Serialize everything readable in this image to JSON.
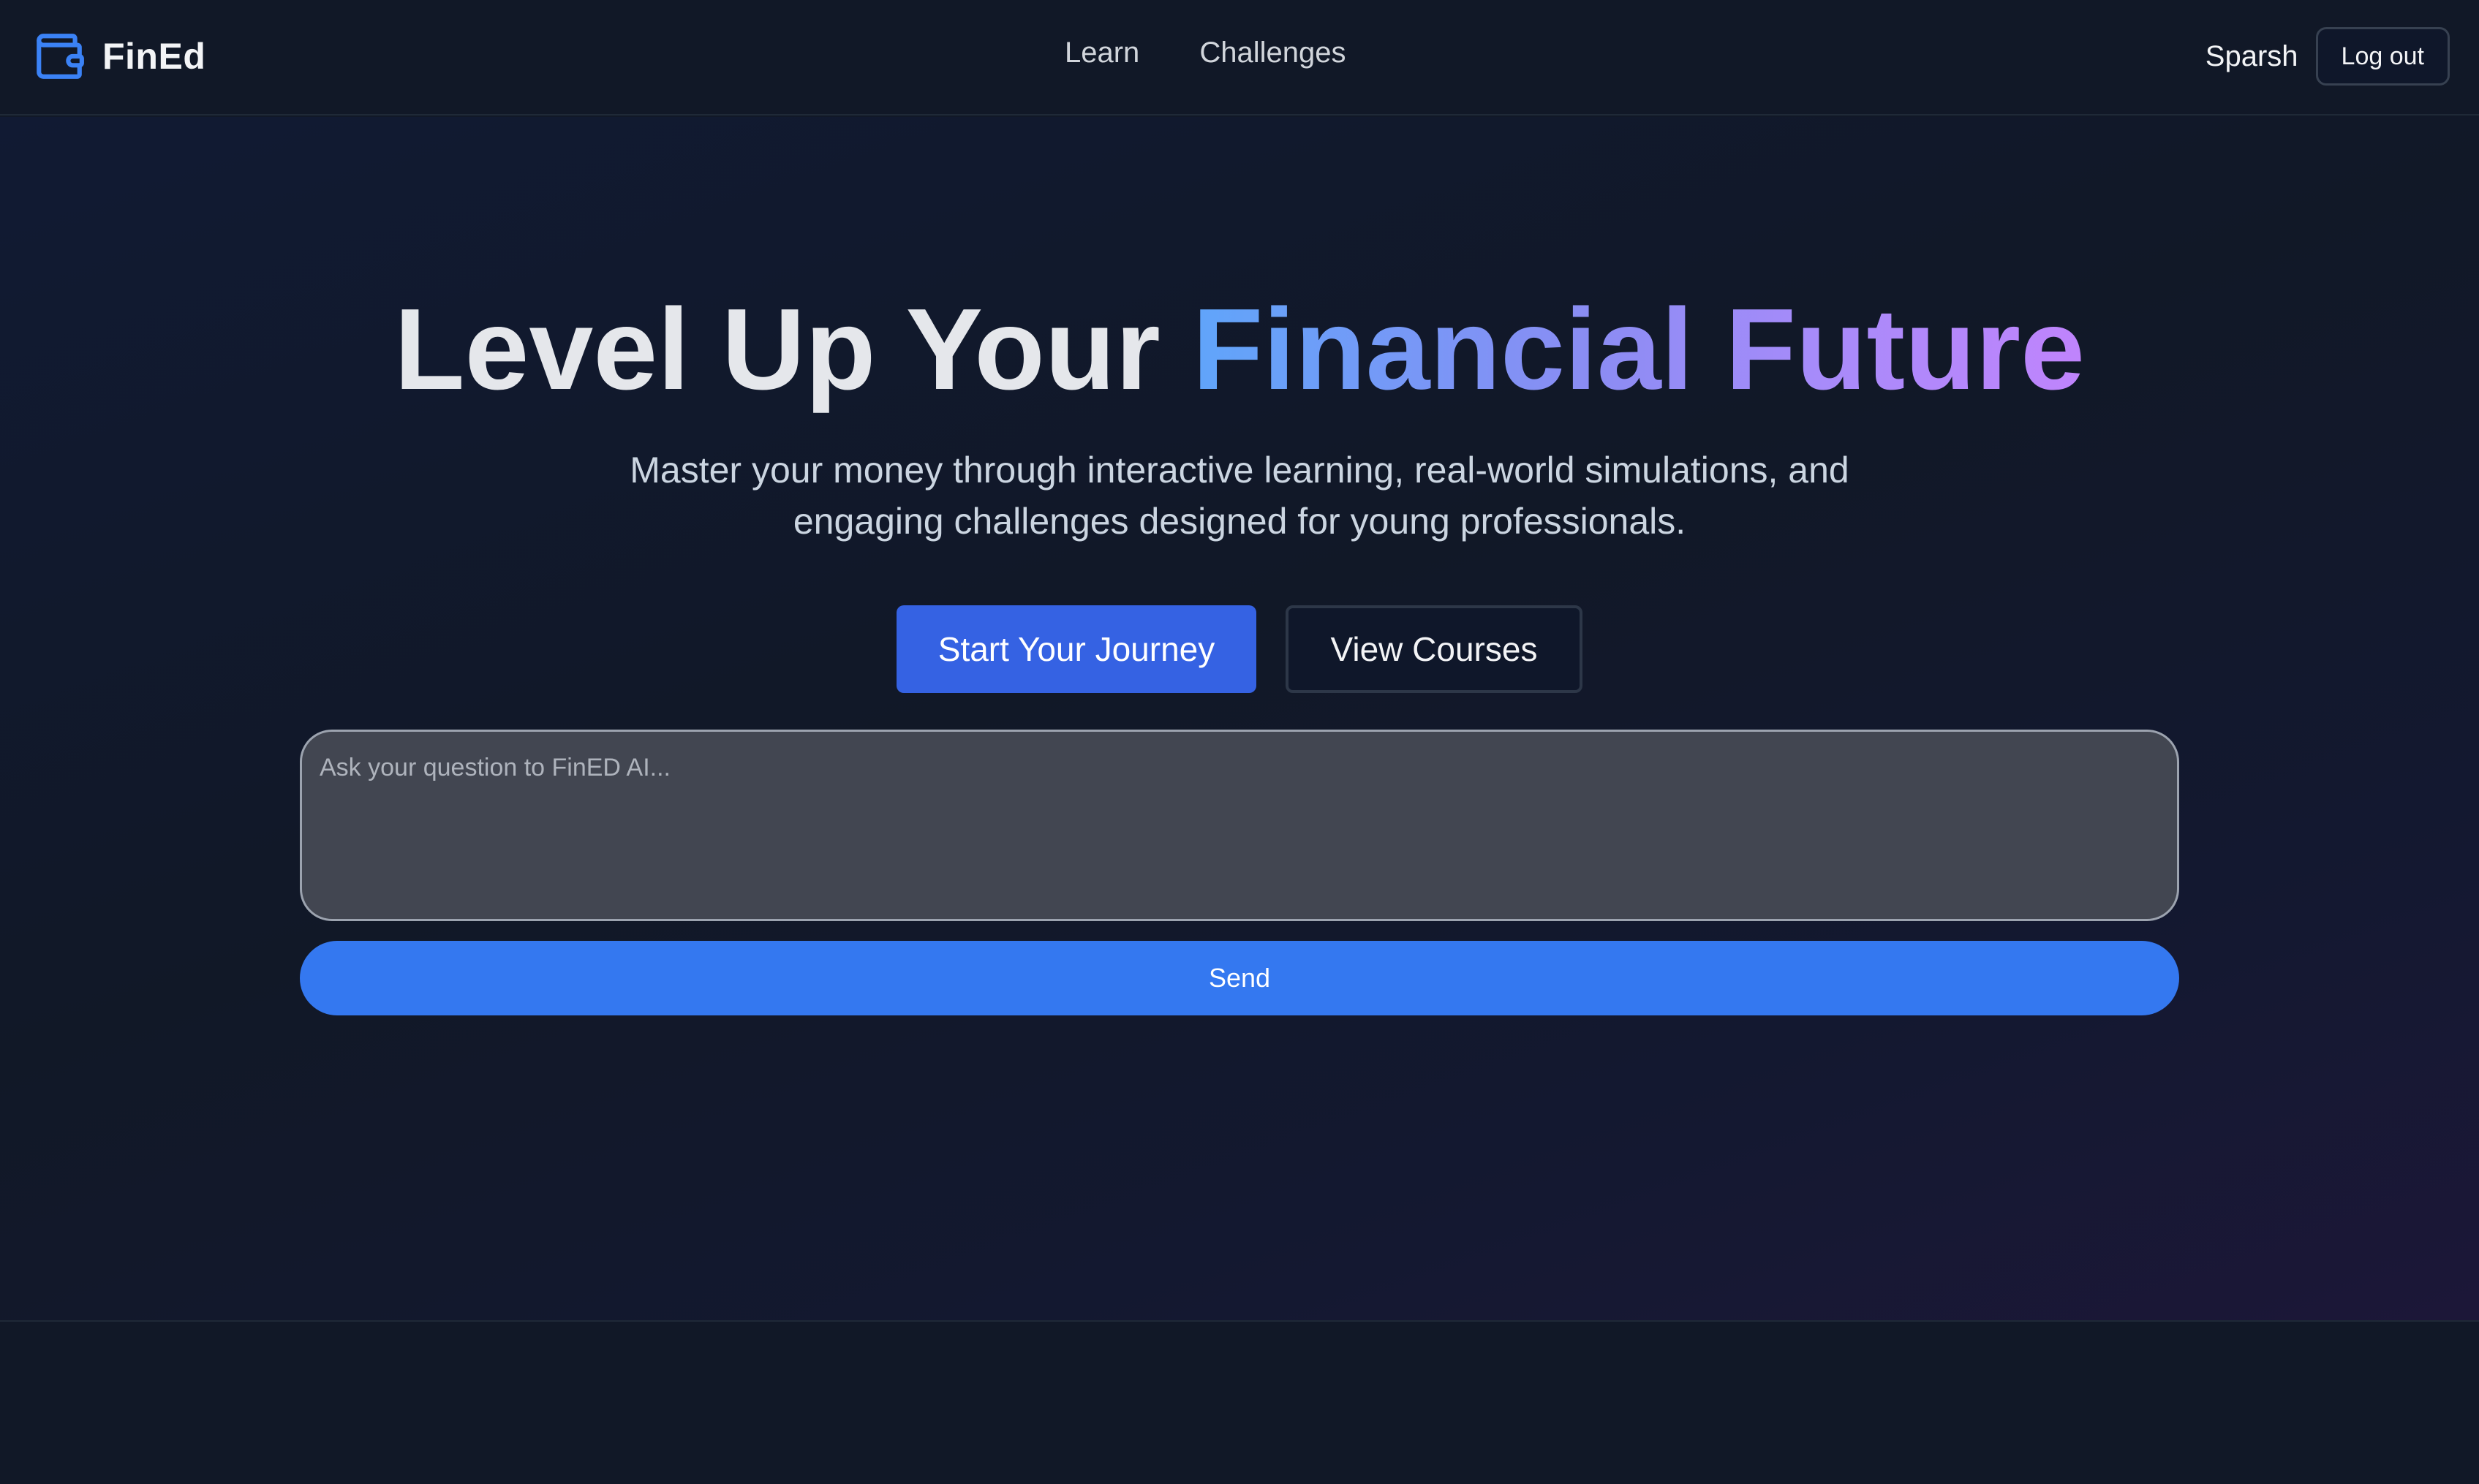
{
  "brand": {
    "name": "FinEd",
    "icon": "wallet-icon",
    "accent_color": "#3b82f6"
  },
  "nav": {
    "items": [
      {
        "label": "Learn"
      },
      {
        "label": "Challenges"
      }
    ]
  },
  "user": {
    "name": "Sparsh",
    "logout_label": "Log out"
  },
  "hero": {
    "title_plain": "Level Up Your ",
    "title_accent": "Financial Future",
    "subtitle": "Master your money through interactive learning, real-world simulations, and engaging challenges designed for young professionals.",
    "primary_cta": "Start Your Journey",
    "secondary_cta": "View Courses"
  },
  "ask": {
    "placeholder": "Ask your question to FinED AI...",
    "send_label": "Send"
  },
  "colors": {
    "background": "#111827",
    "primary_button": "#3562e3",
    "send_button": "#3478f0",
    "gradient_start": "#60a5fa",
    "gradient_end": "#c084fc"
  }
}
